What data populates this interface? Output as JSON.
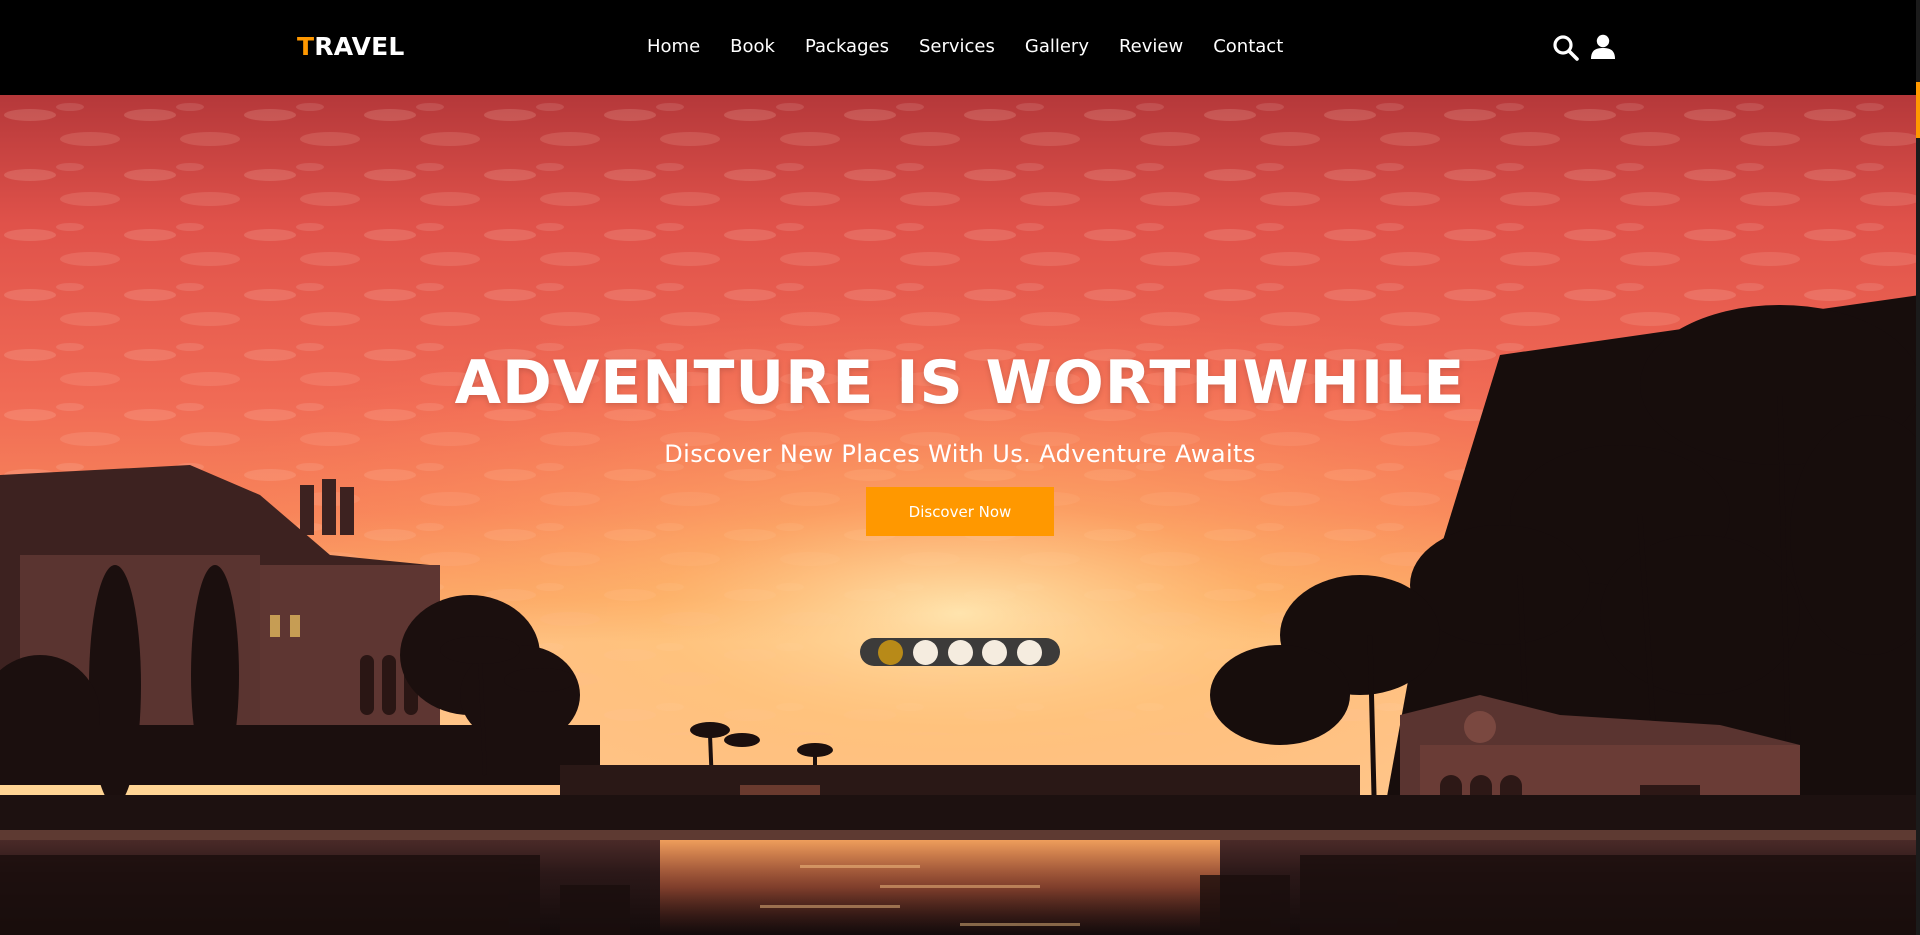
{
  "brand": {
    "initial": "T",
    "rest": "RAVEL"
  },
  "nav": {
    "items": [
      {
        "label": "Home"
      },
      {
        "label": "Book"
      },
      {
        "label": "Packages"
      },
      {
        "label": "Services"
      },
      {
        "label": "Gallery"
      },
      {
        "label": "Review"
      },
      {
        "label": "Contact"
      }
    ]
  },
  "header_icons": {
    "search": "search-icon",
    "user": "user-icon"
  },
  "hero": {
    "title": "ADVENTURE IS WORTHWHILE",
    "subtitle": "Discover New Places With Us. Adventure Awaits",
    "cta_label": "Discover Now",
    "slider": {
      "count": 5,
      "active_index": 0
    }
  },
  "colors": {
    "accent": "#ff9800",
    "header_bg": "#000000",
    "text": "#ffffff"
  }
}
